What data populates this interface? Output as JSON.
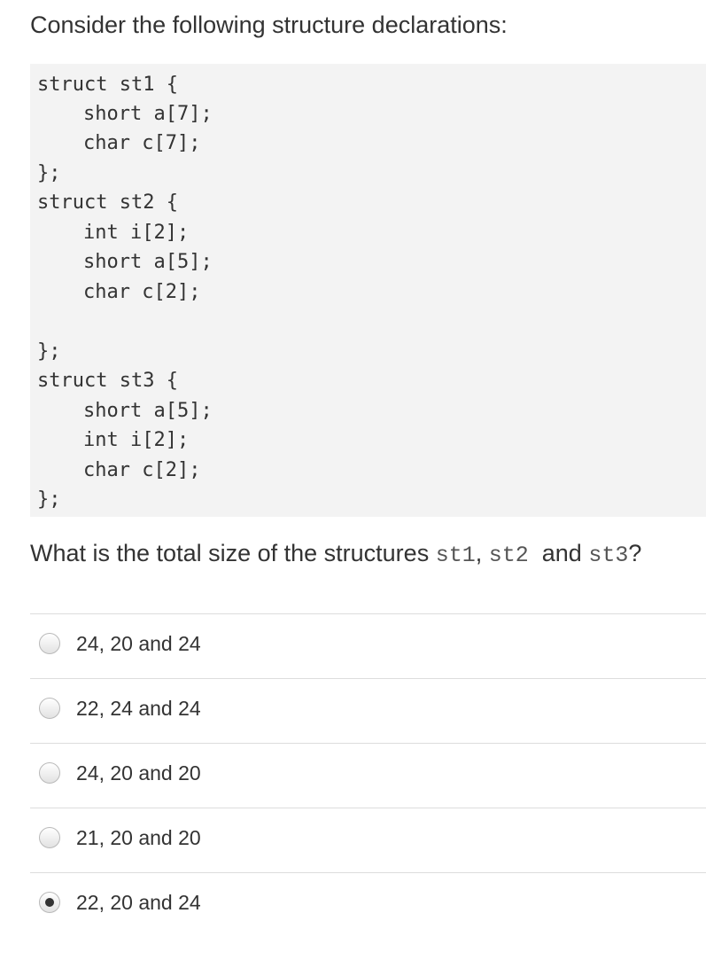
{
  "question": {
    "title": "Consider the following structure declarations:",
    "code_lines": [
      "struct st1 {",
      "short a[7];",
      "char c[7];",
      "};",
      "struct st2 {",
      "int i[2];",
      "short a[5];",
      "char c[2];",
      "",
      "};",
      "struct st3 {",
      "short a[5];",
      "int i[2];",
      "char c[2];",
      "};"
    ],
    "prompt": {
      "prefix": "What is the total size of the structures ",
      "code1": "st1",
      "sep1": ", ",
      "code2": "st2",
      "sep2": "  and ",
      "code3": "st3",
      "suffix": "?"
    }
  },
  "options": [
    {
      "label": "24, 20 and 24",
      "selected": false
    },
    {
      "label": "22, 24 and 24",
      "selected": false
    },
    {
      "label": "24, 20 and 20",
      "selected": false
    },
    {
      "label": "21, 20 and 20",
      "selected": false
    },
    {
      "label": "22, 20 and 24",
      "selected": true
    }
  ]
}
